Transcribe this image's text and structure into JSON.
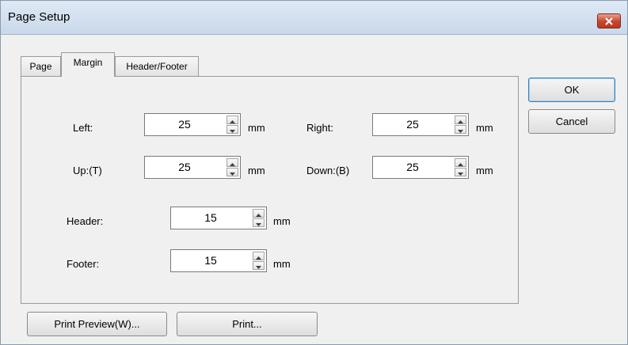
{
  "window": {
    "title": "Page Setup"
  },
  "tabs": [
    {
      "label": "Page"
    },
    {
      "label": "Margin"
    },
    {
      "label": "Header/Footer"
    }
  ],
  "fields": {
    "left": {
      "label": "Left:",
      "value": "25",
      "unit": "mm"
    },
    "right": {
      "label": "Right:",
      "value": "25",
      "unit": "mm"
    },
    "up": {
      "label": "Up:(T)",
      "value": "25",
      "unit": "mm"
    },
    "down": {
      "label": "Down:(B)",
      "value": "25",
      "unit": "mm"
    },
    "header": {
      "label": "Header:",
      "value": "15",
      "unit": "mm"
    },
    "footer": {
      "label": "Footer:",
      "value": "15",
      "unit": "mm"
    }
  },
  "buttons": {
    "ok": "OK",
    "cancel": "Cancel",
    "print_preview": "Print Preview(W)...",
    "print": "Print..."
  },
  "colors": {
    "close_button": "#c7452b",
    "title_bar": "#d4e1f0"
  }
}
